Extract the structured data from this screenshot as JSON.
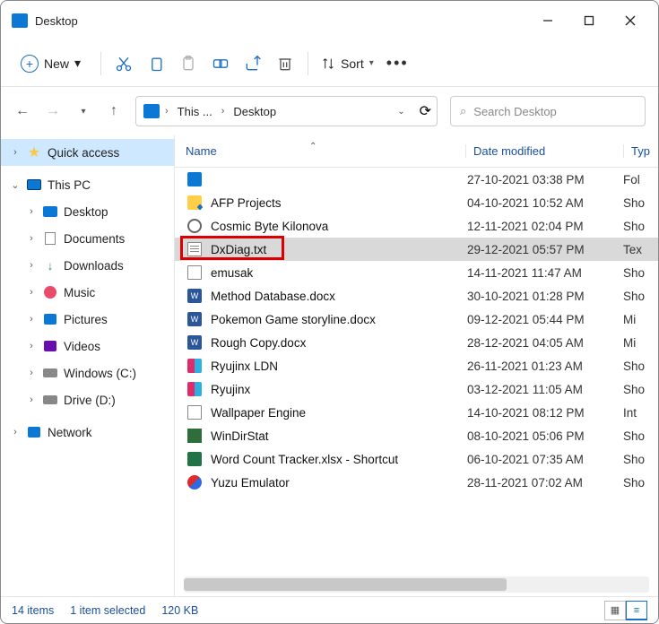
{
  "window": {
    "title": "Desktop"
  },
  "toolbar": {
    "new": "New",
    "sort": "Sort"
  },
  "breadcrumb": {
    "root": "This ...",
    "leaf": "Desktop"
  },
  "search": {
    "placeholder": "Search Desktop"
  },
  "sidebar": {
    "quick": "Quick access",
    "pc": "This PC",
    "desktop": "Desktop",
    "documents": "Documents",
    "downloads": "Downloads",
    "music": "Music",
    "pictures": "Pictures",
    "videos": "Videos",
    "drivec": "Windows (C:)",
    "drived": "Drive (D:)",
    "network": "Network"
  },
  "columns": {
    "name": "Name",
    "date": "Date modified",
    "type": "Typ"
  },
  "files": [
    {
      "name": "",
      "date": "27-10-2021 03:38 PM",
      "type": "Fol",
      "icon": "desktop"
    },
    {
      "name": "AFP Projects",
      "date": "04-10-2021 10:52 AM",
      "type": "Sho",
      "icon": "folder"
    },
    {
      "name": "Cosmic Byte Kilonova",
      "date": "12-11-2021 02:04 PM",
      "type": "Sho",
      "icon": "gear"
    },
    {
      "name": "DxDiag.txt",
      "date": "29-12-2021 05:57 PM",
      "type": "Tex",
      "icon": "txt",
      "selected": true,
      "highlight": true
    },
    {
      "name": "emusak",
      "date": "14-11-2021 11:47 AM",
      "type": "Sho",
      "icon": "lnk"
    },
    {
      "name": "Method Database.docx",
      "date": "30-10-2021 01:28 PM",
      "type": "Sho",
      "icon": "docx"
    },
    {
      "name": "Pokemon Game storyline.docx",
      "date": "09-12-2021 05:44 PM",
      "type": "Mi",
      "icon": "docx"
    },
    {
      "name": "Rough Copy.docx",
      "date": "28-12-2021 04:05 AM",
      "type": "Mi",
      "icon": "docx"
    },
    {
      "name": "Ryujinx LDN",
      "date": "26-11-2021 01:23 AM",
      "type": "Sho",
      "icon": "ryujinx"
    },
    {
      "name": "Ryujinx",
      "date": "03-12-2021 11:05 AM",
      "type": "Sho",
      "icon": "ryujinx"
    },
    {
      "name": "Wallpaper Engine",
      "date": "14-10-2021 08:12 PM",
      "type": "Int",
      "icon": "lnk"
    },
    {
      "name": "WinDirStat",
      "date": "08-10-2021 05:06 PM",
      "type": "Sho",
      "icon": "wds"
    },
    {
      "name": "Word Count Tracker.xlsx - Shortcut",
      "date": "06-10-2021 07:35 AM",
      "type": "Sho",
      "icon": "xlsx"
    },
    {
      "name": "Yuzu Emulator",
      "date": "28-11-2021 07:02 AM",
      "type": "Sho",
      "icon": "yuzu"
    }
  ],
  "status": {
    "count": "14 items",
    "selected": "1 item selected",
    "size": "120 KB"
  }
}
